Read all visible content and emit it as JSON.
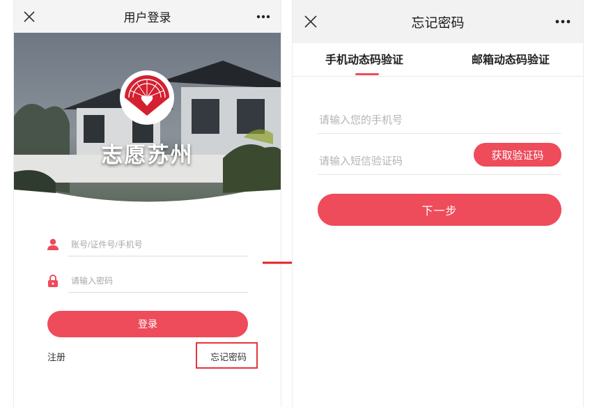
{
  "left_screen": {
    "title": "用户登录",
    "brand_text": "志愿苏州",
    "account_field": {
      "placeholder": "账号/证件号/手机号",
      "value": ""
    },
    "password_field": {
      "placeholder": "请输入密码",
      "value": ""
    },
    "login_label": "登录",
    "register_label": "注册",
    "forgot_label": "忘记密码"
  },
  "right_screen": {
    "title": "忘记密码",
    "tabs": [
      {
        "label": "手机动态码验证",
        "active": true
      },
      {
        "label": "邮箱动态码验证",
        "active": false
      }
    ],
    "phone_field": {
      "placeholder": "请输入您的手机号",
      "value": ""
    },
    "code_field": {
      "placeholder": "请输入短信验证码",
      "value": ""
    },
    "get_code_label": "获取验证码",
    "next_label": "下一步"
  },
  "icons": {
    "close": "close-icon",
    "more": "more-dots-icon",
    "user": "user-icon",
    "lock": "lock-icon",
    "arrow": "right-arrow-icon",
    "logo": "fan-heart-logo"
  },
  "colors": {
    "accent": "#ee4b5b",
    "highlight": "#e8323a",
    "titlebar": "#f4f4f4"
  }
}
